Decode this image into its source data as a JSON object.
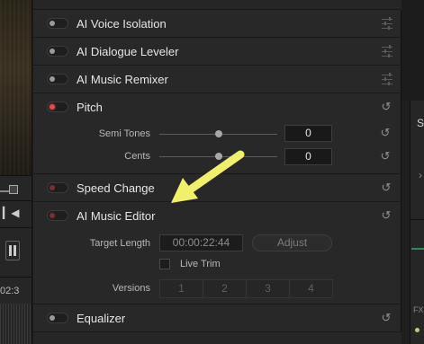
{
  "left_strip": {
    "timecode": "02:3"
  },
  "effects": {
    "voice_isolation": {
      "label": "AI Voice Isolation",
      "enabled": false,
      "icon": "sliders-icon"
    },
    "dialogue_leveler": {
      "label": "AI Dialogue Leveler",
      "enabled": false,
      "icon": "sliders-icon"
    },
    "music_remixer": {
      "label": "AI Music Remixer",
      "enabled": false,
      "icon": "sliders-icon"
    },
    "pitch": {
      "label": "Pitch",
      "enabled": true,
      "icon": "reset-icon",
      "semi_tones": {
        "label": "Semi Tones",
        "value": "0",
        "level": 0.5
      },
      "cents": {
        "label": "Cents",
        "value": "0",
        "level": 0.5
      }
    },
    "speed_change": {
      "label": "Speed Change",
      "enabled": false,
      "icon": "reset-icon"
    },
    "music_editor": {
      "label": "AI Music Editor",
      "enabled": false,
      "icon": "reset-icon",
      "target_length_label": "Target Length",
      "target_length_value": "00:00:22:44",
      "adjust_label": "Adjust",
      "live_trim_label": "Live Trim",
      "live_trim_checked": false,
      "versions_label": "Versions",
      "versions": [
        "1",
        "2",
        "3",
        "4"
      ]
    },
    "equalizer": {
      "label": "Equalizer",
      "enabled": false,
      "icon": "reset-icon"
    }
  },
  "right_strip": {
    "letter": "S",
    "fx_label": "FX"
  },
  "colors": {
    "accent_on": "#e84a4a",
    "annotation_arrow": "#f1f06a",
    "panel_bg": "#282828"
  }
}
